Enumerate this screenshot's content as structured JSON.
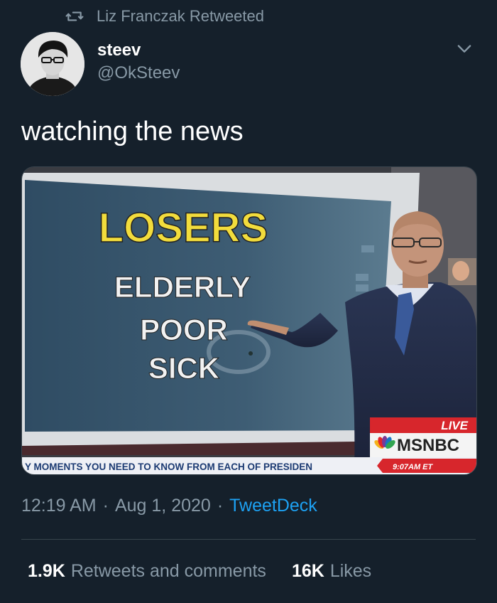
{
  "retweet": {
    "text": "Liz Franczak Retweeted",
    "icon": "retweet-icon"
  },
  "author": {
    "display_name": "steev",
    "handle": "@OkSteev"
  },
  "tweet": {
    "text": "watching the news"
  },
  "media": {
    "board_words": [
      "LOSERS",
      "ELDERLY",
      "POOR",
      "SICK"
    ],
    "live_label": "LIVE",
    "network": "MSNBC",
    "ticker": "Y MOMENTS YOU NEED TO KNOW FROM EACH OF PRESIDEN",
    "ticker_time": "9:07AM ET"
  },
  "meta": {
    "time": "12:19 AM",
    "date": "Aug 1, 2020",
    "source": "TweetDeck"
  },
  "stats": {
    "retweets_count": "1.9K",
    "retweets_label": "Retweets and comments",
    "likes_count": "16K",
    "likes_label": "Likes"
  },
  "colors": {
    "background": "#15202b",
    "secondary_text": "#8899a6",
    "link": "#1da1f2",
    "divider": "#38444d"
  }
}
